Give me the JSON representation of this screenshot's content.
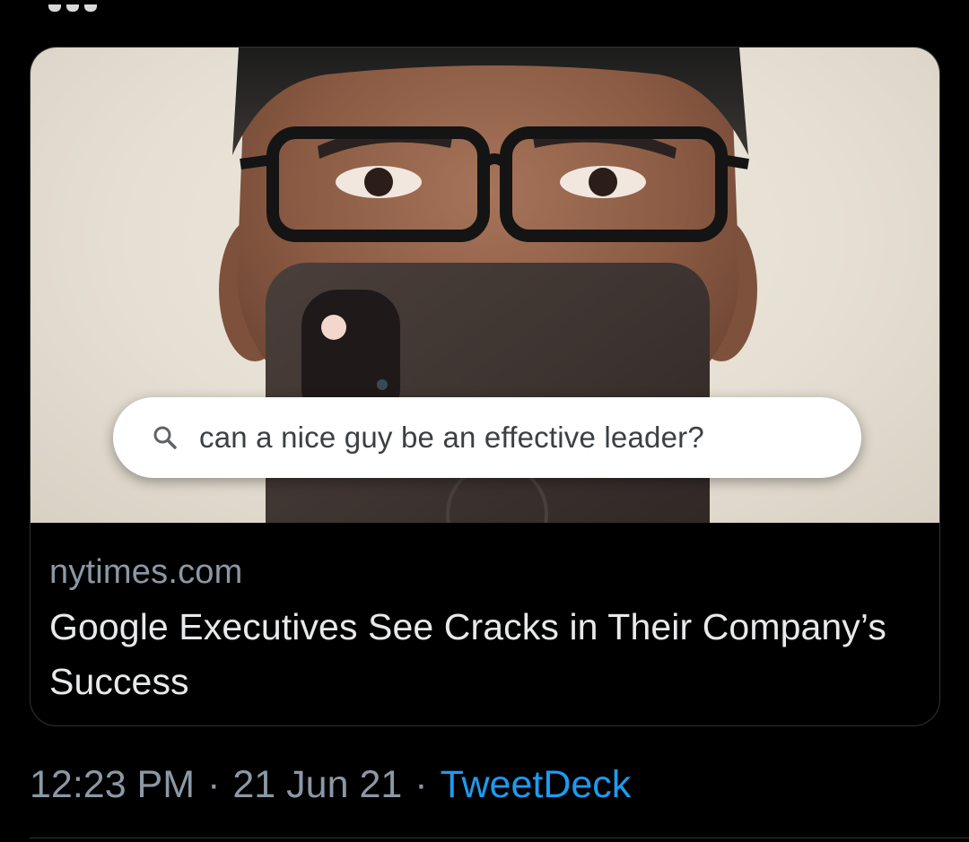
{
  "card": {
    "search_query": "can a nice guy be an effective leader?",
    "domain": "nytimes.com",
    "title": "Google Executives See Cracks in Their Company’s Success",
    "image_icon": "search-icon"
  },
  "meta": {
    "time": "12:23 PM",
    "separator": "·",
    "date": "21 Jun 21",
    "source": "TweetDeck"
  },
  "colors": {
    "background": "#000000",
    "card_border": "#2f3336",
    "muted_text": "#8b98a5",
    "primary_text": "#e7e9ea",
    "link_blue": "#1d9bf0"
  }
}
